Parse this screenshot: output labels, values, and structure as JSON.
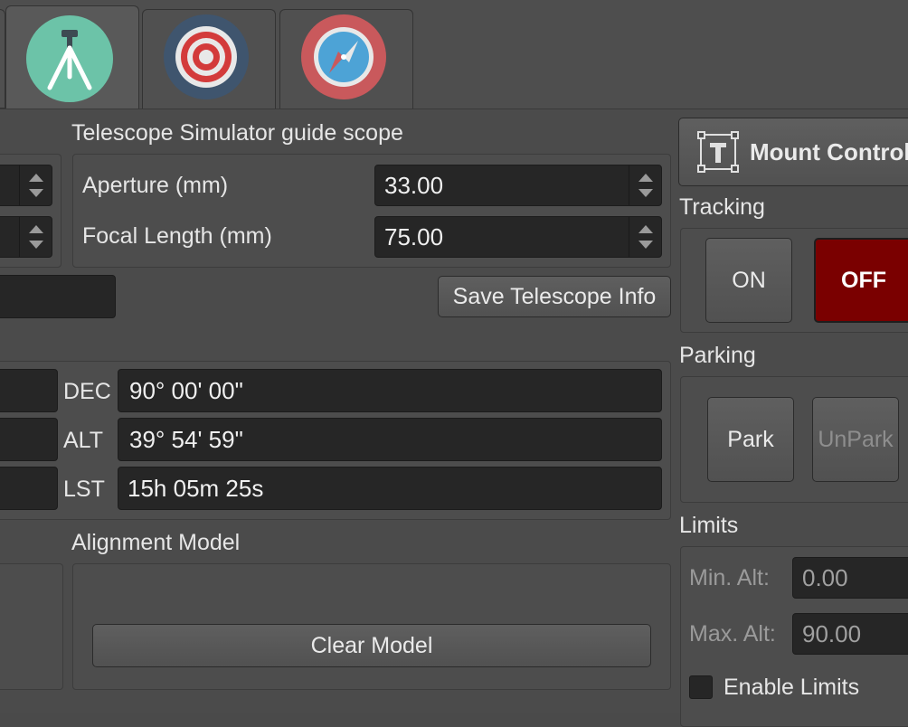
{
  "telescope_section": {
    "title": "Telescope Simulator guide scope",
    "aperture_label": "Aperture (mm)",
    "aperture_value": "33.00",
    "focal_label": "Focal Length (mm)",
    "focal_value": "75.00",
    "save_button": "Save Telescope Info"
  },
  "coords": {
    "dec_label": "DEC",
    "dec_value": "90° 00' 00\"",
    "alt_label": "ALT",
    "alt_value": "39° 54' 59\"",
    "lst_label": "LST",
    "lst_value": "15h 05m 25s"
  },
  "alignment": {
    "title": "Alignment Model",
    "clear_button": "Clear  Model"
  },
  "mount_control": {
    "button_label": "Mount Control",
    "tracking_title": "Tracking",
    "on_button": "ON",
    "off_button": "OFF",
    "parking_title": "Parking",
    "park_button": "Park",
    "unpark_button": "UnPark",
    "limits_title": "Limits",
    "min_alt_label": "Min. Alt:",
    "min_alt_value": "0.00",
    "max_alt_label": "Max. Alt:",
    "max_alt_value": "90.00",
    "enable_limits_label": "Enable Limits"
  },
  "tabs": [
    {
      "icon": "tripod-icon",
      "active": true
    },
    {
      "icon": "target-icon",
      "active": false
    },
    {
      "icon": "compass-icon",
      "active": false
    }
  ],
  "colors": {
    "tripod_bg": "#6cc3a8",
    "target_bg": "#3f556e",
    "compass_bg": "#c9595c",
    "off_button_bg": "#7a0000"
  }
}
